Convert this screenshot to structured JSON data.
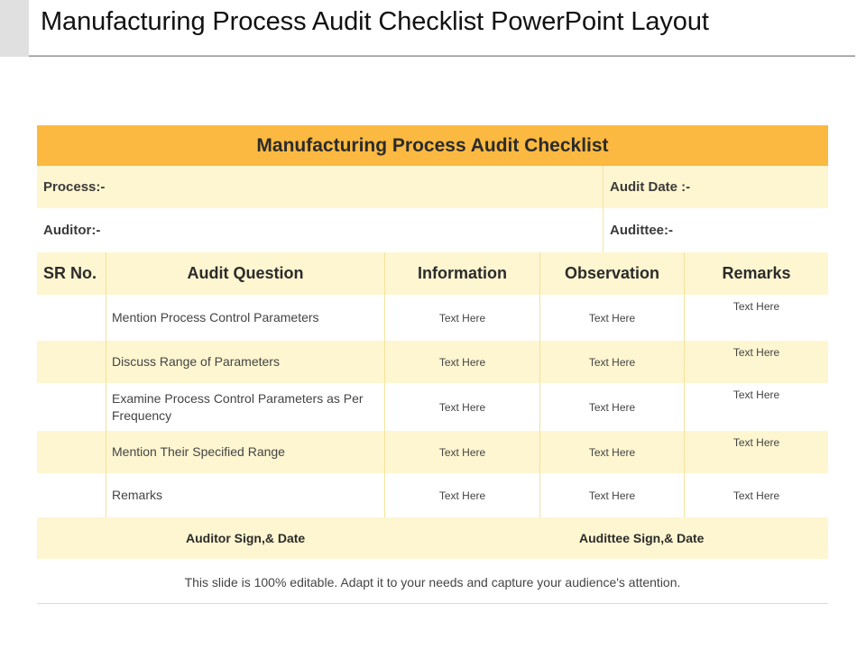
{
  "slide": {
    "title": "Manufacturing Process Audit Checklist PowerPoint Layout",
    "footer_note": "This slide is 100% editable. Adapt it to your needs and capture your audience's attention."
  },
  "checklist": {
    "banner_title": "Manufacturing Process Audit Checklist",
    "meta": {
      "process_label": "Process:-",
      "audit_date_label": "Audit Date :-",
      "auditor_label": "Auditor:-",
      "auditee_label": "Audittee:-"
    },
    "columns": [
      "SR No.",
      "Audit Question",
      "Information",
      "Observation",
      "Remarks"
    ],
    "rows": [
      {
        "sr": "",
        "question": "Mention  Process Control Parameters",
        "information": "Text Here",
        "observation": "Text Here",
        "remarks": "Text Here"
      },
      {
        "sr": "",
        "question": "Discuss Range of Parameters",
        "information": "Text Here",
        "observation": "Text Here",
        "remarks": "Text Here"
      },
      {
        "sr": "",
        "question": "Examine Process Control Parameters as Per Frequency",
        "information": "Text Here",
        "observation": "Text Here",
        "remarks": "Text Here"
      },
      {
        "sr": "",
        "question": "Mention  Their Specified Range",
        "information": "Text Here",
        "observation": "Text Here",
        "remarks": "Text Here"
      },
      {
        "sr": "",
        "question": "Remarks",
        "information": "Text Here",
        "observation": "Text Here",
        "remarks": "Text Here"
      }
    ],
    "signatures": {
      "auditor": "Auditor  Sign,& Date",
      "auditee": "Audittee Sign,& Date"
    }
  },
  "colors": {
    "banner": "#fbb941",
    "row_tint": "#fef6d0",
    "divider": "#f3e39a"
  }
}
